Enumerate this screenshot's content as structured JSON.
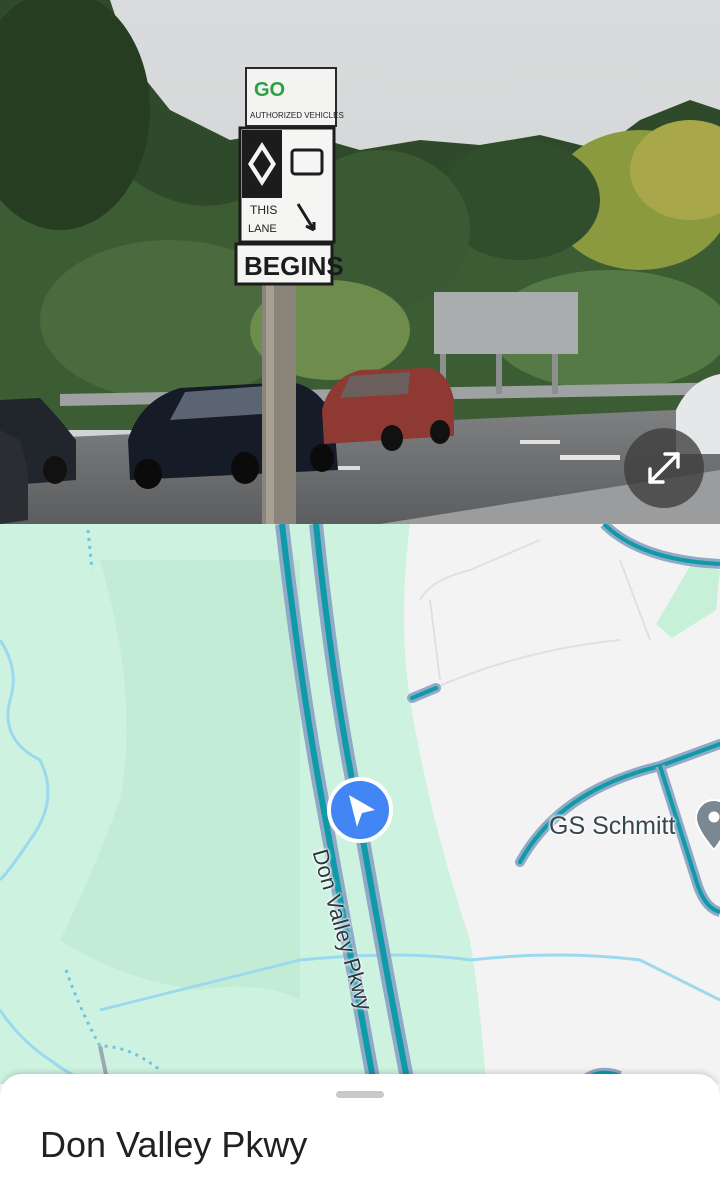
{
  "street_view": {
    "sign_brand": "GO",
    "sign_line1": "AUTHORIZED VEHICLES",
    "sign_line2": "THIS",
    "sign_line3": "LANE",
    "sign_begins": "BEGINS",
    "expand_icon": "expand-diagonal-icon"
  },
  "map": {
    "road_label": "Don Valley Pkwy",
    "poi_label": "GS Schmitt",
    "poi_icon": "place-pin-icon",
    "location_icon": "navigation-arrow-icon",
    "colors": {
      "park": "#cdf3e0",
      "park_dark": "#c1ebd4",
      "land": "#f4f3f3",
      "highway": "#0e9aa7",
      "highway_edge": "#8fa9c7",
      "water": "#9bd9ef",
      "location": "#4285f4"
    }
  },
  "sheet": {
    "title": "Don Valley Pkwy"
  }
}
